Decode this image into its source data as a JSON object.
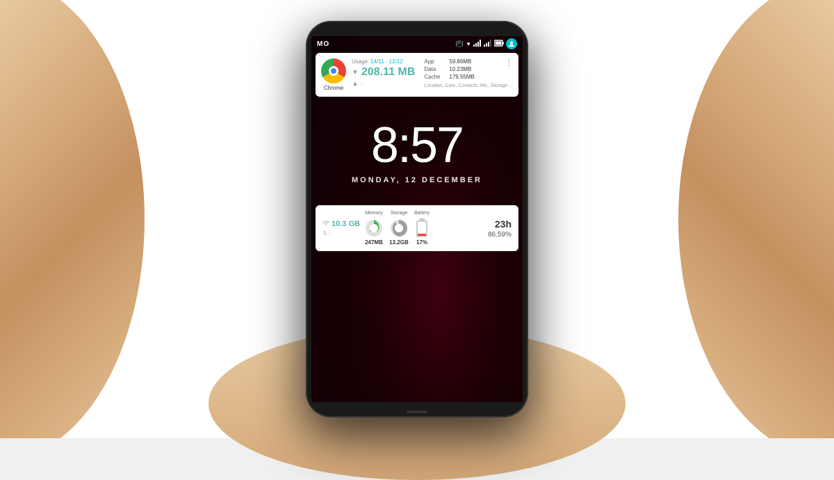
{
  "scene": {
    "background": "white"
  },
  "status_bar": {
    "carrier": "MO",
    "icons": [
      "vibrate",
      "wifi",
      "signal1",
      "signal2",
      "battery"
    ],
    "avatar_initial": "person"
  },
  "chrome_widget": {
    "app_name": "Chrome",
    "usage_label": "Usage",
    "usage_date": "14/11 - 12/12",
    "download_amount": "208.11 MB",
    "upload_amount": "-",
    "app_label": "App",
    "app_value": "59.86MB",
    "data_label": "Data",
    "data_value": "10.23MB",
    "cache_label": "Cache",
    "cache_value": "179.55MB",
    "permissions": "Location, Cam, Contacts, Mic, Storage ...",
    "more_dots": "⋮"
  },
  "clock": {
    "time": "8:57",
    "date": "MONDAY, 12 DECEMBER"
  },
  "stats_widget": {
    "wifi_data": "10.3 GB",
    "upload_label": "-",
    "memory_label": "Memory",
    "memory_value": "247MB",
    "memory_used_pct": 30,
    "storage_label": "Storage",
    "storage_value": "13.2GB",
    "storage_used_pct": 55,
    "battery_label": "Battery",
    "battery_value": "17%",
    "battery_fill_pct": 17,
    "duration_hours": "23h",
    "duration_pct": "86.59%"
  }
}
